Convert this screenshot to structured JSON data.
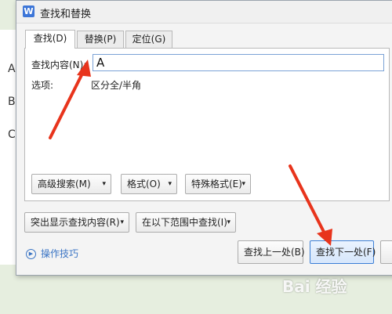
{
  "window": {
    "title": "查找和替换",
    "icon": "W"
  },
  "tabs": [
    {
      "label": "查找(D)",
      "active": true
    },
    {
      "label": "替换(P)",
      "active": false
    },
    {
      "label": "定位(G)",
      "active": false
    }
  ],
  "find": {
    "label": "查找内容(N):",
    "value": "A"
  },
  "options": {
    "label": "选项:",
    "value": "区分全/半角"
  },
  "buttons": {
    "advanced_search": "高级搜索(M)",
    "format": "格式(O)",
    "special_format": "特殊格式(E)",
    "highlight": "突出显示查找内容(R)",
    "find_in": "在以下范围中查找(I)",
    "find_previous": "查找上一处(B)",
    "find_next": "查找下一处(F)"
  },
  "tips": {
    "label": "操作技巧"
  },
  "background_doc": {
    "letters": [
      "A",
      "B",
      "C"
    ]
  },
  "watermark": "Bai 经验",
  "colors": {
    "accent": "#3c7fd6",
    "arrow": "#e8341c",
    "link": "#3a74c4"
  },
  "icons": {
    "caret_down": "caret-down-icon",
    "play_circle": "play-circle-icon"
  }
}
